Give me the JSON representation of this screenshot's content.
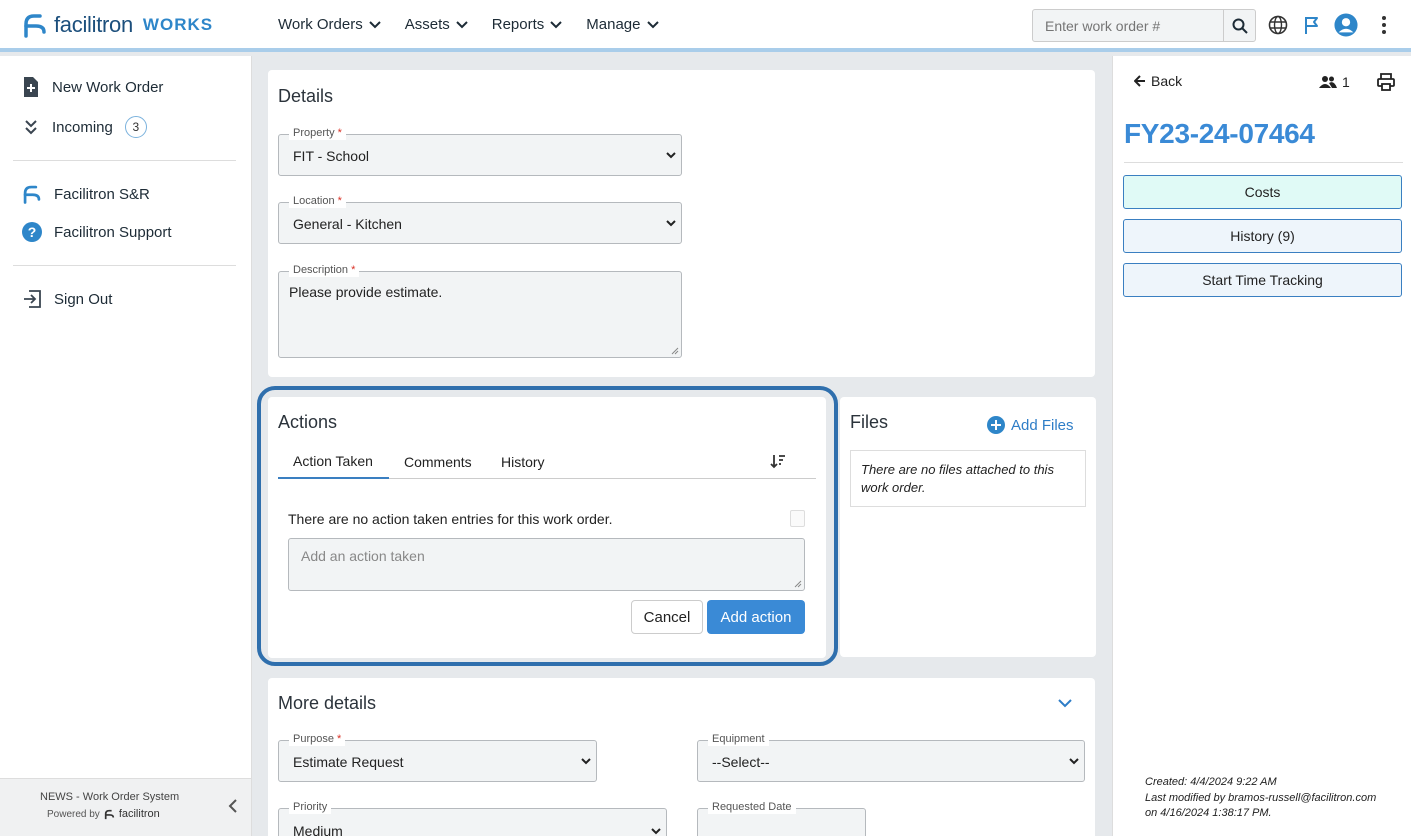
{
  "app": {
    "brand": "facilitron",
    "brand_suffix": "WORKS"
  },
  "nav": {
    "items": [
      {
        "label": "Work Orders"
      },
      {
        "label": "Assets"
      },
      {
        "label": "Reports"
      },
      {
        "label": "Manage"
      }
    ]
  },
  "search": {
    "placeholder": "Enter work order #"
  },
  "sidebar": {
    "new_work_order": "New Work Order",
    "incoming": "Incoming",
    "incoming_count": "3",
    "facilitron_sr": "Facilitron S&R",
    "facilitron_support": "Facilitron Support",
    "sign_out": "Sign Out",
    "footer_title": "NEWS - Work Order System",
    "footer_powered": "Powered by",
    "footer_brand": "facilitron"
  },
  "details": {
    "title": "Details",
    "property_label": "Property",
    "property_value": "FIT - School",
    "location_label": "Location",
    "location_value": "General - Kitchen",
    "description_label": "Description",
    "description_value": "Please provide estimate."
  },
  "actions": {
    "title": "Actions",
    "tabs": [
      "Action Taken",
      "Comments",
      "History"
    ],
    "empty_text": "There are no action taken entries for this work order.",
    "input_placeholder": "Add an action taken",
    "cancel": "Cancel",
    "add": "Add action"
  },
  "files": {
    "title": "Files",
    "add": "Add Files",
    "empty_text": "There are no files attached to this work order."
  },
  "more_details": {
    "title": "More details",
    "purpose_label": "Purpose",
    "purpose_value": "Estimate Request",
    "equipment_label": "Equipment",
    "equipment_value": "--Select--",
    "priority_label": "Priority",
    "priority_value": "Medium",
    "requested_date_label": "Requested Date"
  },
  "right_panel": {
    "back": "Back",
    "people_count": "1",
    "work_order_id": "FY23-24-07464",
    "costs": "Costs",
    "history": "History (9)",
    "time_tracking": "Start Time Tracking",
    "created": "Created: 4/4/2024 9:22 AM",
    "modified": "Last modified by bramos-russell@facilitron.com on 4/16/2024 1:38:17 PM."
  },
  "colors": {
    "accent": "#3a8ad6",
    "brand_dark": "#1c4f7c",
    "highlight_ring": "#2f6fad",
    "costs_bg": "#e0faf6",
    "button_bg": "#eef5fb"
  }
}
